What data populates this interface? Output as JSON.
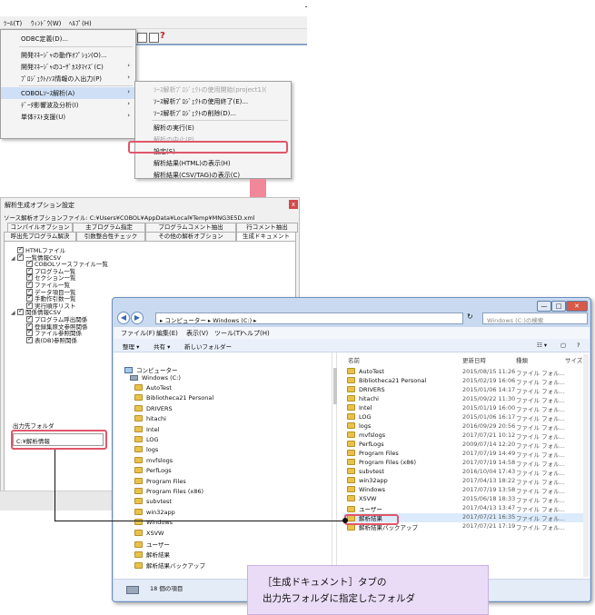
{
  "menubar": {
    "items": [
      "ﾂｰﾙ(T)",
      "ｳｨﾝﾄﾞｳ(W)",
      "ﾍﾙﾌﾟ(H)"
    ]
  },
  "tools_menu": {
    "items": [
      {
        "label": "ODBC定義(D)...",
        "arrow": ""
      },
      {
        "label": "開発ﾏﾈｰｼﾞｬの動作ｵﾌﾟｼｮﾝ(O)...",
        "arrow": ""
      },
      {
        "label": "開発ﾏﾈｰｼﾞｬのﾕｰｻﾞｶｽﾀﾏｲｽﾞ(C)",
        "arrow": "›"
      },
      {
        "label": "ﾌﾟﾛｼﾞｪｸﾄ/ｿｽ情報の入出力(P)",
        "arrow": "›"
      },
      {
        "label": "COBOLｿｰｽ解析(A)",
        "arrow": "›"
      },
      {
        "label": "ﾃﾞｰﾀ影響波及分析(I)",
        "arrow": "›"
      },
      {
        "label": "単体ﾃｽﾄ支援(U)",
        "arrow": "›"
      }
    ]
  },
  "analysis_menu": {
    "items": [
      {
        "label": "ｿｰｽ解析ﾌﾟﾛｼﾞｪｸﾄの使用開始(project1)(",
        "disabled": true
      },
      {
        "label": "ｿｰｽ解析ﾌﾟﾛｼﾞｪｸﾄの使用終了(E)...",
        "disabled": false
      },
      {
        "label": "ｿｰｽ解析ﾌﾟﾛｼﾞｪｸﾄの削除(D)...",
        "disabled": false
      },
      {
        "label": "解析の実行(E)",
        "disabled": false
      },
      {
        "label": "解析の中止(P)",
        "disabled": true
      },
      {
        "label": "設定(S)...",
        "disabled": false
      },
      {
        "label": "解析結果(HTML)の表示(H)",
        "disabled": false
      },
      {
        "label": "解析結果(CSV/TAG)の表示(C)",
        "disabled": false
      }
    ]
  },
  "dialog": {
    "title": "解析生成オプション設定",
    "close": "x",
    "file_label": "ソース解析オプションファイル:  C:¥Users¥COBOL¥AppData¥Local¥Temp¥MNG3E5D.xml",
    "tabs_row1": [
      "コンパイルオプション",
      "主プログラム指定",
      "プログラムコメント抽出",
      "行コメント抽出"
    ],
    "tabs_row2": [
      "呼出先プログラム解決",
      "引数整合性チェック",
      "その他の解析オプション",
      "生成ドキュメント"
    ],
    "tree": [
      {
        "label": "HTMLファイル",
        "level": 1,
        "toggle": ""
      },
      {
        "label": "一覧情報CSV",
        "level": 1,
        "toggle": "◢"
      },
      {
        "label": "COBOLソースファイル一覧",
        "level": 2,
        "toggle": ""
      },
      {
        "label": "プログラム一覧",
        "level": 2,
        "toggle": ""
      },
      {
        "label": "セクション一覧",
        "level": 2,
        "toggle": ""
      },
      {
        "label": "ファイル一覧",
        "level": 2,
        "toggle": ""
      },
      {
        "label": "データ項目一覧",
        "level": 2,
        "toggle": ""
      },
      {
        "label": "手動作引数一覧",
        "level": 2,
        "toggle": ""
      },
      {
        "label": "実行順序リスト",
        "level": 2,
        "toggle": ""
      },
      {
        "label": "関係情報CSV",
        "level": 1,
        "toggle": "◢"
      },
      {
        "label": "プログラム呼出関係",
        "level": 2,
        "toggle": ""
      },
      {
        "label": "登録集原文参照関係",
        "level": 2,
        "toggle": ""
      },
      {
        "label": "ファイル参照関係",
        "level": 2,
        "toggle": ""
      },
      {
        "label": "表(DB)参照関係",
        "level": 2,
        "toggle": ""
      }
    ],
    "output_label": "出力先フォルダ",
    "output_value": "C:¥解析情報"
  },
  "explorer": {
    "controls": [
      "—",
      "□",
      "✕"
    ],
    "nav_back": "◀",
    "nav_fwd": "▶",
    "address": "▸ コンピューター ▸ Windows (C:) ▸",
    "refresh": "↻",
    "search_placeholder": "Windows (C:)の検索",
    "menu": [
      "ファイル(F)",
      "編集(E)",
      "表示(V)",
      "ツール(T)",
      "ヘルプ(H)"
    ],
    "toolbar": [
      "整理 ▾",
      "共有 ▾",
      "新しいフォルダー"
    ],
    "view_icons": [
      "☷ ▾",
      "▢",
      "?"
    ],
    "tree_root": "コンピューター",
    "tree_drive": "Windows (C:)",
    "tree_folders": [
      "AutoTest",
      "Bibliotheca21 Personal",
      "DRIVERS",
      "hitachi",
      "Intel",
      "LOG",
      "logs",
      "mvfslogs",
      "PerfLogs",
      "Program Files",
      "Program Files (x86)",
      "subvtest",
      "win32app",
      "Windows",
      "XSVW",
      "ユーザー",
      "解析結果",
      "解析結果バックアップ"
    ],
    "columns": [
      "名前",
      "更新日時",
      "種類",
      "サイズ"
    ],
    "files": [
      {
        "name": "AutoTest",
        "date": "2015/08/15 11:26",
        "type": "ファイル フォル..."
      },
      {
        "name": "Bibliotheca21 Personal",
        "date": "2015/02/19 16:06",
        "type": "ファイル フォル..."
      },
      {
        "name": "DRIVERS",
        "date": "2015/01/06 14:17",
        "type": "ファイル フォル..."
      },
      {
        "name": "hitachi",
        "date": "2015/09/22 11:30",
        "type": "ファイル フォル..."
      },
      {
        "name": "Intel",
        "date": "2015/01/19 16:00",
        "type": "ファイル フォル..."
      },
      {
        "name": "LOG",
        "date": "2015/01/06 16:17",
        "type": "ファイル フォル..."
      },
      {
        "name": "logs",
        "date": "2016/09/29 20:56",
        "type": "ファイル フォル..."
      },
      {
        "name": "mvfslogs",
        "date": "2017/07/21 10:12",
        "type": "ファイル フォル..."
      },
      {
        "name": "PerfLogs",
        "date": "2009/07/14 12:20",
        "type": "ファイル フォル..."
      },
      {
        "name": "Program Files",
        "date": "2017/07/19 14:49",
        "type": "ファイル フォル..."
      },
      {
        "name": "Program Files (x86)",
        "date": "2017/07/19 14:58",
        "type": "ファイル フォル..."
      },
      {
        "name": "subvtest",
        "date": "2016/10/04 17:43",
        "type": "ファイル フォル..."
      },
      {
        "name": "win32app",
        "date": "2017/04/13 18:22",
        "type": "ファイル フォル..."
      },
      {
        "name": "Windows",
        "date": "2017/07/19 13:58",
        "type": "ファイル フォル..."
      },
      {
        "name": "XSVW",
        "date": "2015/06/18 18:33",
        "type": "ファイル フォル..."
      },
      {
        "name": "ユーザー",
        "date": "2017/04/13 13:47",
        "type": "ファイル フォル..."
      },
      {
        "name": "解析結果",
        "date": "2017/07/21 16:35",
        "type": "ファイル フォル..."
      },
      {
        "name": "解析結果バックアップ",
        "date": "2017/07/21 17:19",
        "type": "ファイル フォル..."
      }
    ],
    "status": "18 個の項目"
  },
  "callout": {
    "line1": "［生成ドキュメント］タブの",
    "line2": "出力先フォルダに指定したフォルダ"
  },
  "colors": {
    "highlight": "#e0566a",
    "arrow": "#f0879a",
    "callout_bg": "#eadcf7"
  }
}
